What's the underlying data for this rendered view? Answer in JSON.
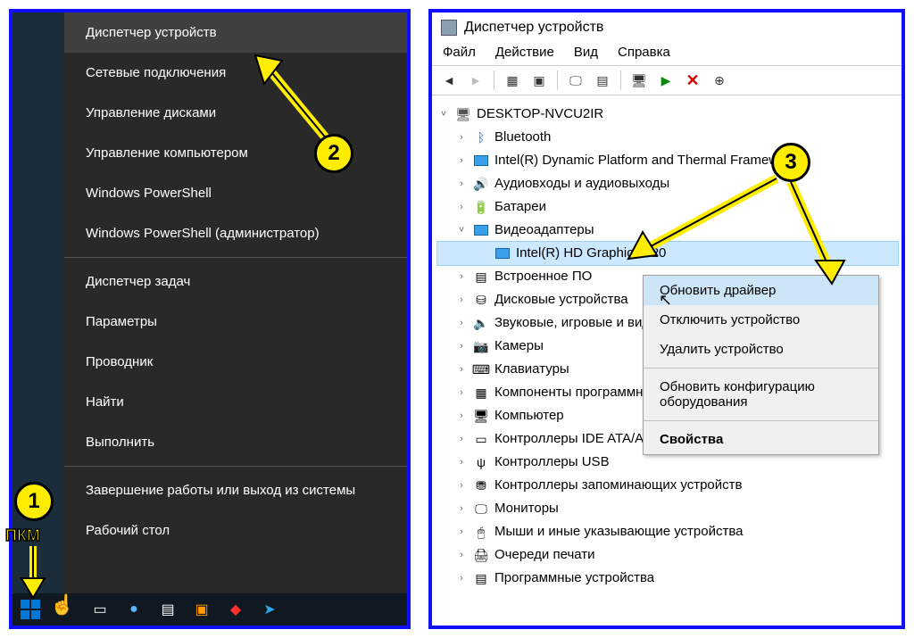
{
  "badges": {
    "one": "1",
    "two": "2",
    "three": "3",
    "pkm": "ПКМ"
  },
  "leftMenu": {
    "items": [
      "Диспетчер устройств",
      "Сетевые подключения",
      "Управление дисками",
      "Управление компьютером",
      "Windows PowerShell",
      "Windows PowerShell (администратор)"
    ],
    "group2": [
      "Диспетчер задач",
      "Параметры",
      "Проводник",
      "Найти",
      "Выполнить"
    ],
    "group3": [
      "Завершение работы или выход из системы",
      "Рабочий стол"
    ]
  },
  "rightWin": {
    "title": "Диспетчер устройств",
    "menu": {
      "file": "Файл",
      "action": "Действие",
      "view": "Вид",
      "help": "Справка"
    },
    "root": "DESKTOP-NVCU2IR",
    "nodes": {
      "bluetooth": "Bluetooth",
      "intel_dptf": "Intel(R) Dynamic Platform and Thermal Framework",
      "audio": "Аудиовходы и аудиовыходы",
      "batt": "Батареи",
      "video": "Видеоадаптеры",
      "gpu": "Intel(R) HD Graphics 620",
      "firmware": "Встроенное ПО",
      "disk": "Дисковые устройства",
      "sound": "Звуковые, игровые и видеоустройства",
      "camera": "Камеры",
      "keyboard": "Клавиатуры",
      "components": "Компоненты программного обеспечения",
      "computer": "Компьютер",
      "ide": "Контроллеры IDE ATA/ATAPI",
      "usb": "Контроллеры USB",
      "storage_ctrl": "Контроллеры запоминающих устройств",
      "monitors": "Мониторы",
      "mouse": "Мыши и иные указывающие устройства",
      "print_queue": "Очереди печати",
      "soft_dev": "Программные устройства"
    }
  },
  "rcMenu": {
    "update": "Обновить драйвер",
    "disable": "Отключить устройство",
    "remove": "Удалить устройство",
    "rescan": "Обновить конфигурацию оборудования",
    "props": "Свойства"
  }
}
